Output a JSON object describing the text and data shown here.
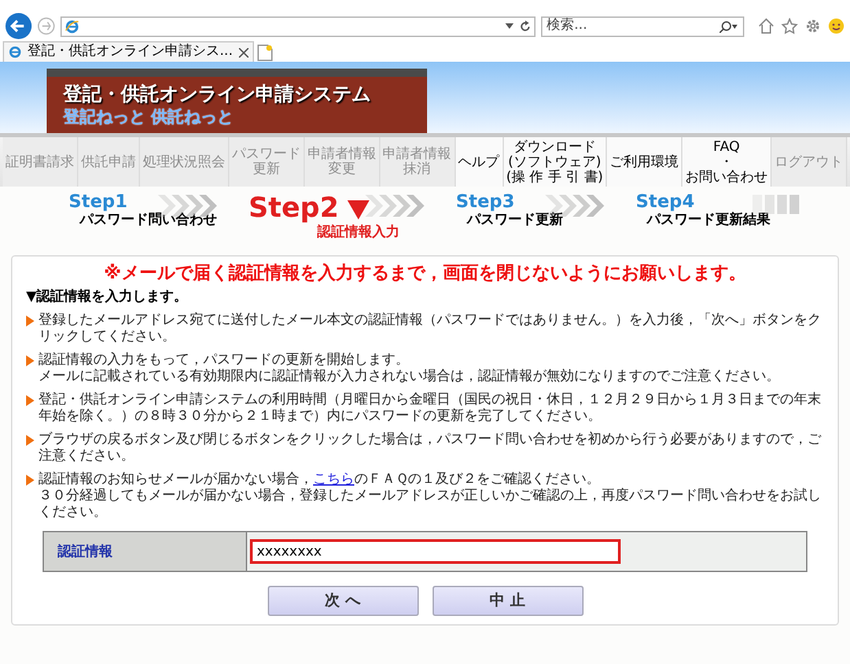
{
  "browser": {
    "search_placeholder": "検索...",
    "tab_title": "登記・供託オンライン申請シス..."
  },
  "banner": {
    "title": "登記・供託オンライン申請システム",
    "subtitle": "登記ねっと 供託ねっと"
  },
  "nav": [
    {
      "lines": [
        "証明書請求"
      ],
      "disabled": true
    },
    {
      "lines": [
        "供託申請"
      ],
      "disabled": true
    },
    {
      "lines": [
        "処理状況照会"
      ],
      "disabled": true
    },
    {
      "lines": [
        "パスワード",
        "更新"
      ],
      "disabled": true
    },
    {
      "lines": [
        "申請者情報",
        "変更"
      ],
      "disabled": true
    },
    {
      "lines": [
        "申請者情報",
        "抹消"
      ],
      "disabled": true
    },
    {
      "lines": [
        "ヘルプ"
      ],
      "disabled": false
    },
    {
      "lines": [
        "ダウンロード",
        "(ソフトウェア)",
        "(操 作 手 引 書)"
      ],
      "disabled": false
    },
    {
      "lines": [
        "ご利用環境"
      ],
      "disabled": false
    },
    {
      "lines": [
        "FAQ",
        "・",
        "お問い合わせ"
      ],
      "disabled": false
    },
    {
      "lines": [
        "ログアウト"
      ],
      "disabled": true
    }
  ],
  "steps": [
    {
      "step": "Step1",
      "caption": "パスワード問い合わせ",
      "current": false
    },
    {
      "step": "Step2",
      "caption": "認証情報入力",
      "current": true
    },
    {
      "step": "Step3",
      "caption": "パスワード更新",
      "current": false
    },
    {
      "step": "Step4",
      "caption": "パスワード更新結果",
      "current": false
    }
  ],
  "notice": "※メールで届く認証情報を入力するまで，画面を閉じないようにお願いします。",
  "section_heading": "▼認証情報を入力します。",
  "bullets": [
    {
      "lines": [
        [
          {
            "text": "登録したメールアドレス宛てに送付したメール本文の認証情報（パスワードではありません。）を入力後，「次へ」ボタンをクリックしてください。",
            "link": false
          }
        ]
      ]
    },
    {
      "lines": [
        [
          {
            "text": "認証情報の入力をもって，パスワードの更新を開始します。",
            "link": false
          }
        ],
        [
          {
            "text": "メールに記載されている有効期限内に認証情報が入力されない場合は，認証情報が無効になりますのでご注意ください。",
            "link": false
          }
        ]
      ]
    },
    {
      "lines": [
        [
          {
            "text": "登記・供託オンライン申請システムの利用時間（月曜日から金曜日（国民の祝日・休日，１２月２９日から１月３日までの年末年始を除く。）の８時３０分から２１時まで）内にパスワードの更新を完了してください。",
            "link": false
          }
        ]
      ]
    },
    {
      "lines": [
        [
          {
            "text": "ブラウザの戻るボタン及び閉じるボタンをクリックした場合は，パスワード問い合わせを初めから行う必要がありますので，ご注意ください。",
            "link": false
          }
        ]
      ]
    },
    {
      "lines": [
        [
          {
            "text": "認証情報のお知らせメールが届かない場合，",
            "link": false
          },
          {
            "text": "こちら",
            "link": true
          },
          {
            "text": "のＦＡＱの１及び２をご確認ください。",
            "link": false
          }
        ],
        [
          {
            "text": "３０分経過してもメールが届かない場合，登録したメールアドレスが正しいかご確認の上，再度パスワード問い合わせをお試しください。",
            "link": false
          }
        ]
      ]
    }
  ],
  "form": {
    "label": "認証情報",
    "value": "xxxxxxxx",
    "highlighted": true
  },
  "buttons": [
    "次 へ",
    "中 止"
  ]
}
